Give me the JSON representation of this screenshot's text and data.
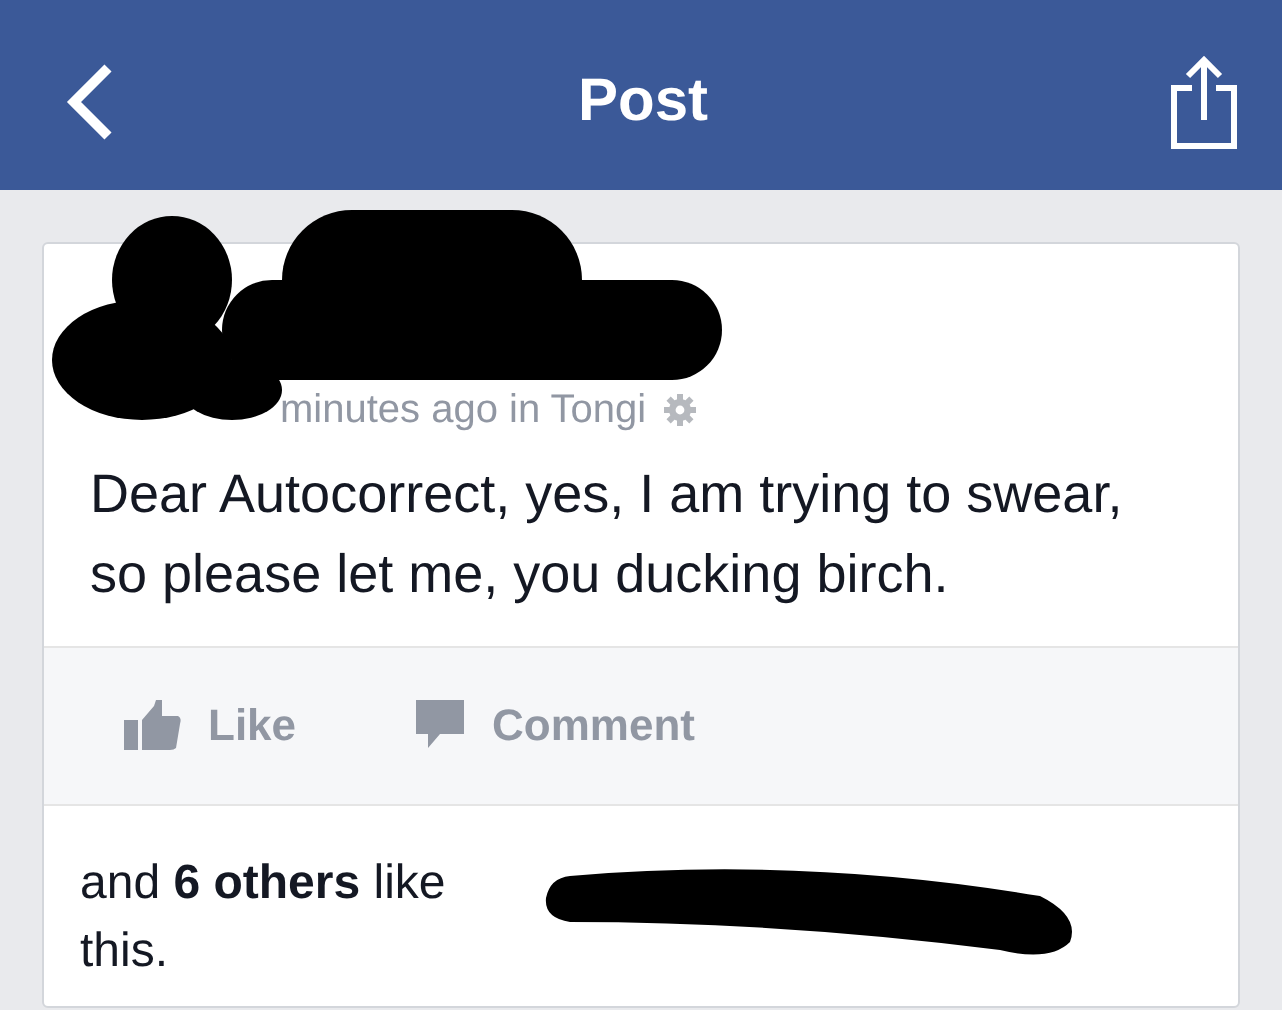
{
  "header": {
    "title": "Post"
  },
  "post": {
    "meta": "minutes ago in Tongi",
    "text": "Dear Autocorrect, yes, I am trying to swear, so please let me, you ducking birch."
  },
  "actions": [
    {
      "kind": "like",
      "label": "Like"
    },
    {
      "kind": "comment",
      "label": "Comment"
    }
  ],
  "likes": {
    "text": "and **6 others** like this."
  }
}
